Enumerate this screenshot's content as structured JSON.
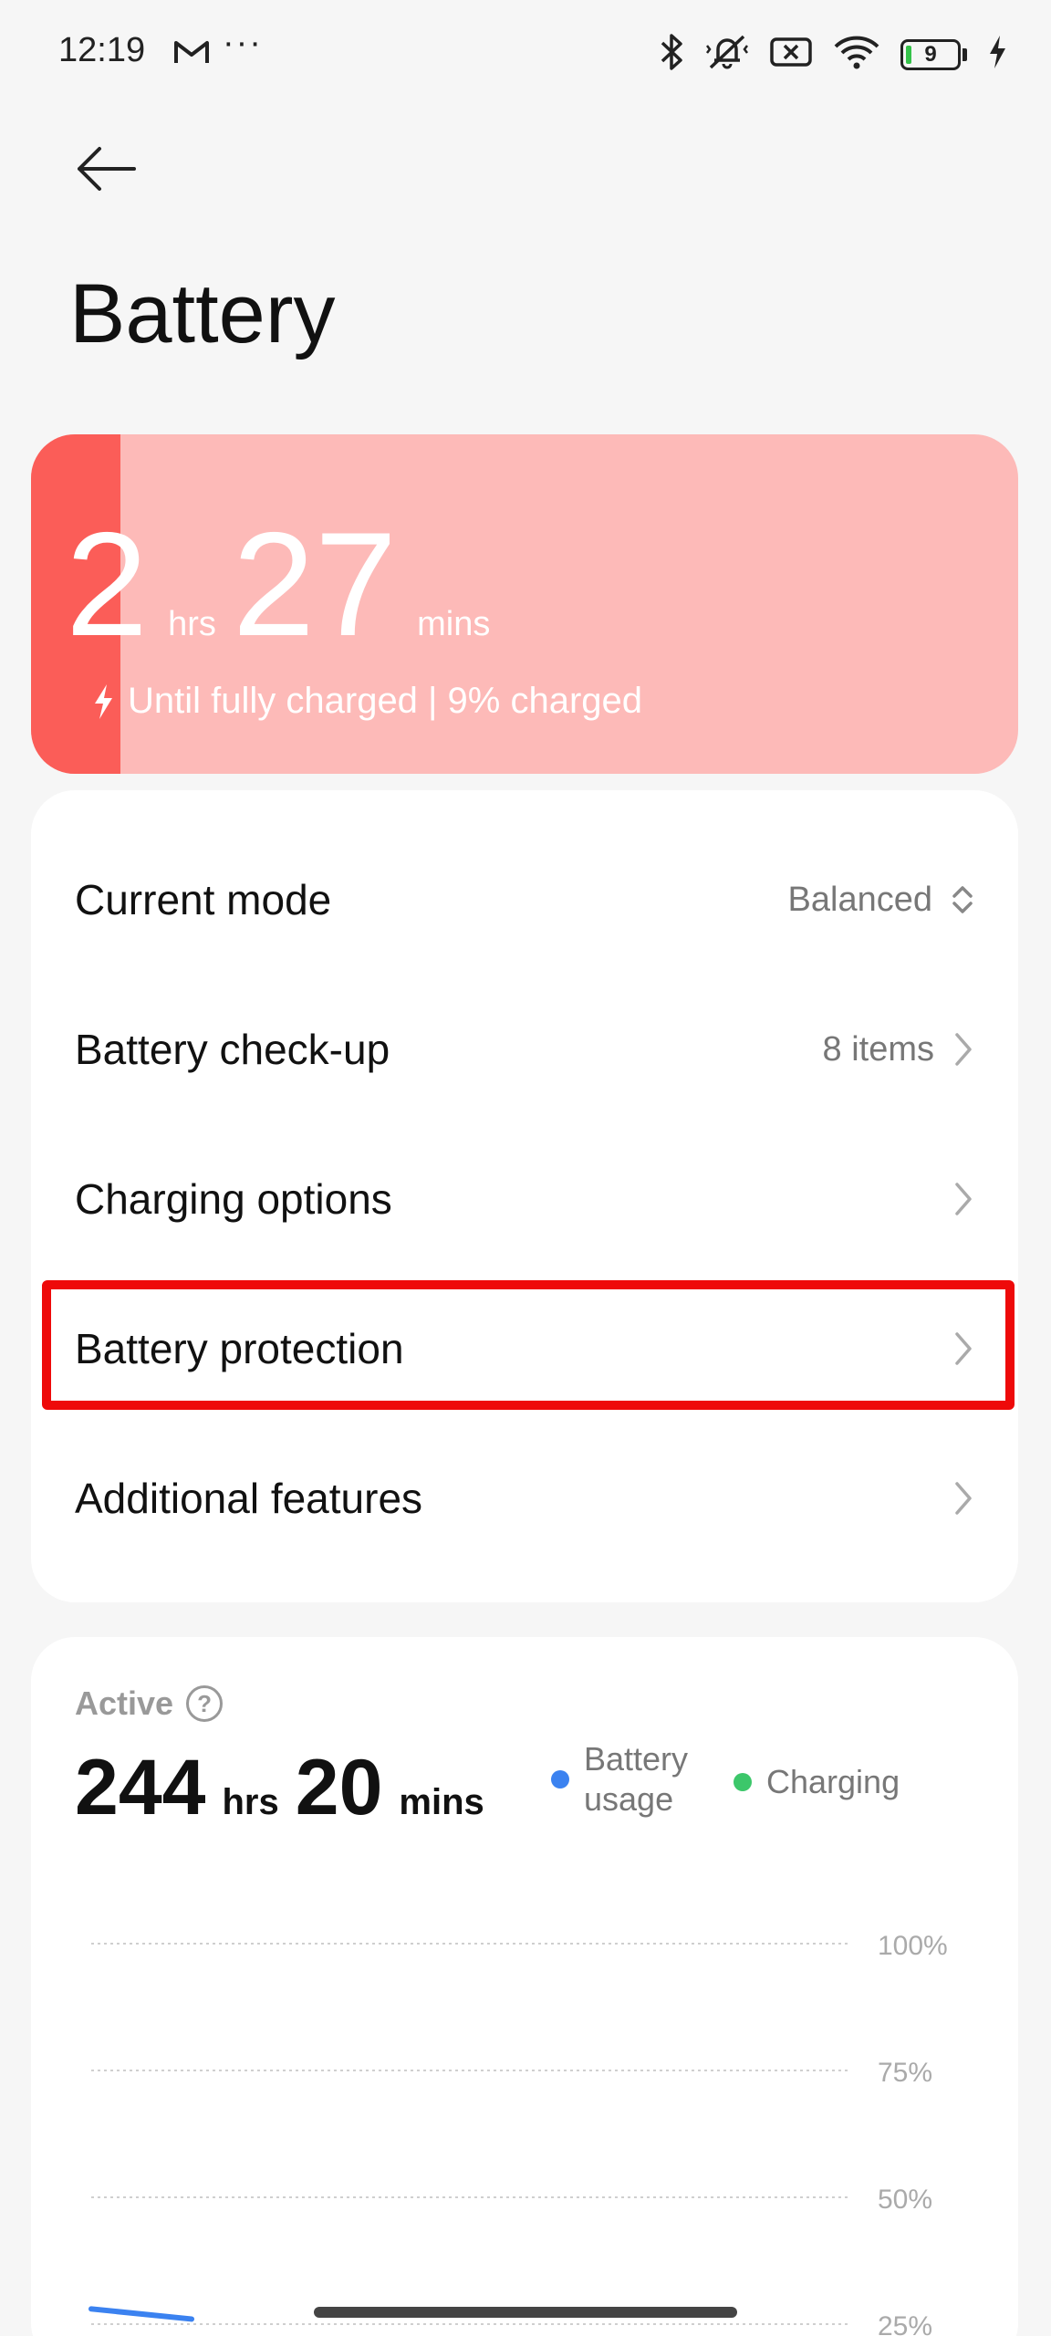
{
  "status_bar": {
    "time": "12:19",
    "more": "···",
    "battery_level": "9",
    "icons": [
      "gmail-icon",
      "bluetooth-icon",
      "mute-vibrate-icon",
      "no-sim-icon",
      "wifi-icon",
      "battery-icon",
      "charging-bolt-icon"
    ]
  },
  "header": {
    "title": "Battery",
    "back_icon": "arrow-left-icon"
  },
  "charge_card": {
    "hours": "2",
    "hours_unit": "hrs",
    "minutes": "27",
    "minutes_unit": "mins",
    "subtitle": "Until fully charged | 9% charged",
    "level_fraction": 0.09,
    "colors": {
      "background": "#fdbab8",
      "level": "#fb5d58"
    }
  },
  "settings": {
    "rows": [
      {
        "label": "Current mode",
        "value": "Balanced",
        "icon": "up-down-chevron-icon"
      },
      {
        "label": "Battery check-up",
        "value": "8 items",
        "icon": "chevron-right-icon"
      },
      {
        "label": "Charging options",
        "value": "",
        "icon": "chevron-right-icon"
      },
      {
        "label": "Battery protection",
        "value": "",
        "icon": "chevron-right-icon",
        "highlighted": true
      },
      {
        "label": "Additional features",
        "value": "",
        "icon": "chevron-right-icon"
      }
    ],
    "highlight_color": "#ee0a0a"
  },
  "active": {
    "label": "Active",
    "help_icon": "question-circle-icon",
    "hours": "244",
    "hours_unit": "hrs",
    "minutes": "20",
    "minutes_unit": "mins",
    "legend": [
      {
        "label": "Battery usage",
        "line1": "Battery",
        "line2": "usage",
        "color": "#3b82f0"
      },
      {
        "label": "Charging",
        "color": "#3cc76a"
      }
    ]
  },
  "chart_data": {
    "type": "line",
    "y_ticks": [
      "100%",
      "75%",
      "50%",
      "25%"
    ],
    "y_tick_values": [
      100,
      75,
      50,
      25
    ],
    "ylim": [
      0,
      100
    ],
    "grid": true,
    "series": [
      {
        "name": "Battery usage",
        "color": "#3b82f0",
        "values": [
          28,
          26
        ]
      }
    ]
  }
}
